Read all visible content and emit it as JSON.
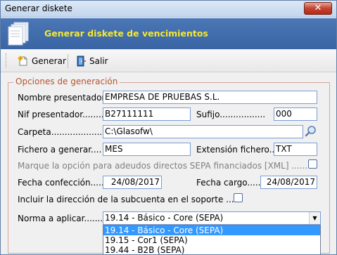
{
  "window": {
    "title": "Generar diskete"
  },
  "banner": {
    "title": "Generar diskete de vencimientos",
    "icon": "document-stack-icon"
  },
  "toolbar": {
    "generar_label": "Generar",
    "salir_label": "Salir"
  },
  "group": {
    "legend": "Opciones de generación"
  },
  "form": {
    "nombre_label": "Nombre presentador.",
    "nombre_value": "EMPRESA DE PRUEBAS S.L.",
    "nif_label": "Nif presentador.........",
    "nif_value": "B27111111",
    "sufijo_label": "Sufijo.................",
    "sufijo_value": "000",
    "carpeta_label": "Carpeta....................",
    "carpeta_value": "C:\\Glasofw\\",
    "fichero_label": "Fichero a generar....",
    "fichero_value": "MES",
    "extension_label": "Extensión fichero...",
    "extension_value": "TXT",
    "sepa_label": "Marque la opción para adeudos directos SEPA financiados [XML] ......",
    "fecha_confeccion_label": "Fecha confección.....",
    "fecha_confeccion_value": "24/08/2017",
    "fecha_cargo_label": "Fecha cargo........",
    "fecha_cargo_value": "24/08/2017",
    "subcuenta_label": "Incluir la dirección de la subcuenta en el soporte ...",
    "norma_label": "Norma a aplicar.........",
    "norma_value": "19.14   - Básico - Core  (SEPA)",
    "norma_options": [
      "19.14   - Básico - Core  (SEPA)",
      "19.15   - Cor1 (SEPA)",
      "19.44   - B2B (SEPA)"
    ]
  },
  "colors": {
    "banner_bg": "#3a64a3",
    "banner_text": "#f7e82c",
    "legend_text": "#b4532f",
    "selection": "#3399ff"
  }
}
